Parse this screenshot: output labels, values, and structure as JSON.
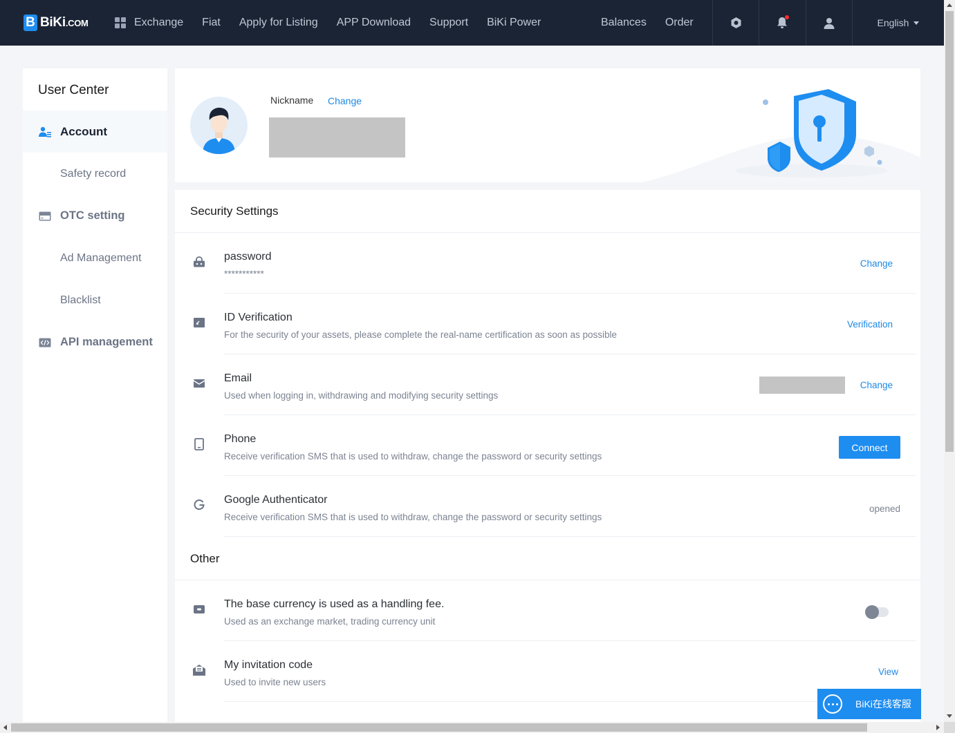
{
  "brand": {
    "mark": "B",
    "name": "BiKi",
    "suffix": ".COM"
  },
  "nav": {
    "left": [
      "Exchange",
      "Fiat",
      "Apply for Listing",
      "APP Download",
      "Support",
      "BiKi Power"
    ],
    "right": [
      "Balances",
      "Order"
    ],
    "language": "English"
  },
  "sidebar": {
    "title": "User Center",
    "items": [
      {
        "label": "Account",
        "icon": "user-icon",
        "active": true
      },
      {
        "label": "Safety record"
      },
      {
        "label": "OTC setting",
        "icon": "card-icon",
        "group": true
      },
      {
        "label": "Ad Management"
      },
      {
        "label": "Blacklist"
      },
      {
        "label": "API management",
        "icon": "code-icon",
        "group": true
      }
    ]
  },
  "profile": {
    "nickname_label": "Nickname",
    "change_label": "Change"
  },
  "security": {
    "title": "Security Settings",
    "rows": [
      {
        "title": "password",
        "desc": "***********",
        "action": "Change",
        "icon": "lock-icon"
      },
      {
        "title": "ID Verification",
        "desc": "For the security of your assets, please complete the real-name certification as soon as possible",
        "action": "Verification",
        "icon": "id-card-icon"
      },
      {
        "title": "Email",
        "desc": "Used when logging in, withdrawing and modifying security settings",
        "action": "Change",
        "icon": "mail-icon"
      },
      {
        "title": "Phone",
        "desc": "Receive verification SMS that is used to withdraw, change the password or security settings",
        "action": "Connect",
        "icon": "phone-icon"
      },
      {
        "title": "Google Authenticator",
        "desc": "Receive verification SMS that is used to withdraw, change the password or security settings",
        "status": "opened",
        "icon": "google-icon"
      }
    ]
  },
  "other": {
    "title": "Other",
    "rows": [
      {
        "title": "The base currency is used as a handling fee.",
        "desc": "Used as an exchange market, trading currency unit",
        "toggle_on": false,
        "icon": "coin-icon"
      },
      {
        "title": "My invitation code",
        "desc": "Used to invite new users",
        "action": "View",
        "icon": "invite-icon"
      }
    ]
  },
  "chat": {
    "label": "BiKi在线客服"
  },
  "colors": {
    "nav_bg": "#1b2435",
    "accent": "#1e8df0",
    "page_bg": "#f3f5f8"
  }
}
